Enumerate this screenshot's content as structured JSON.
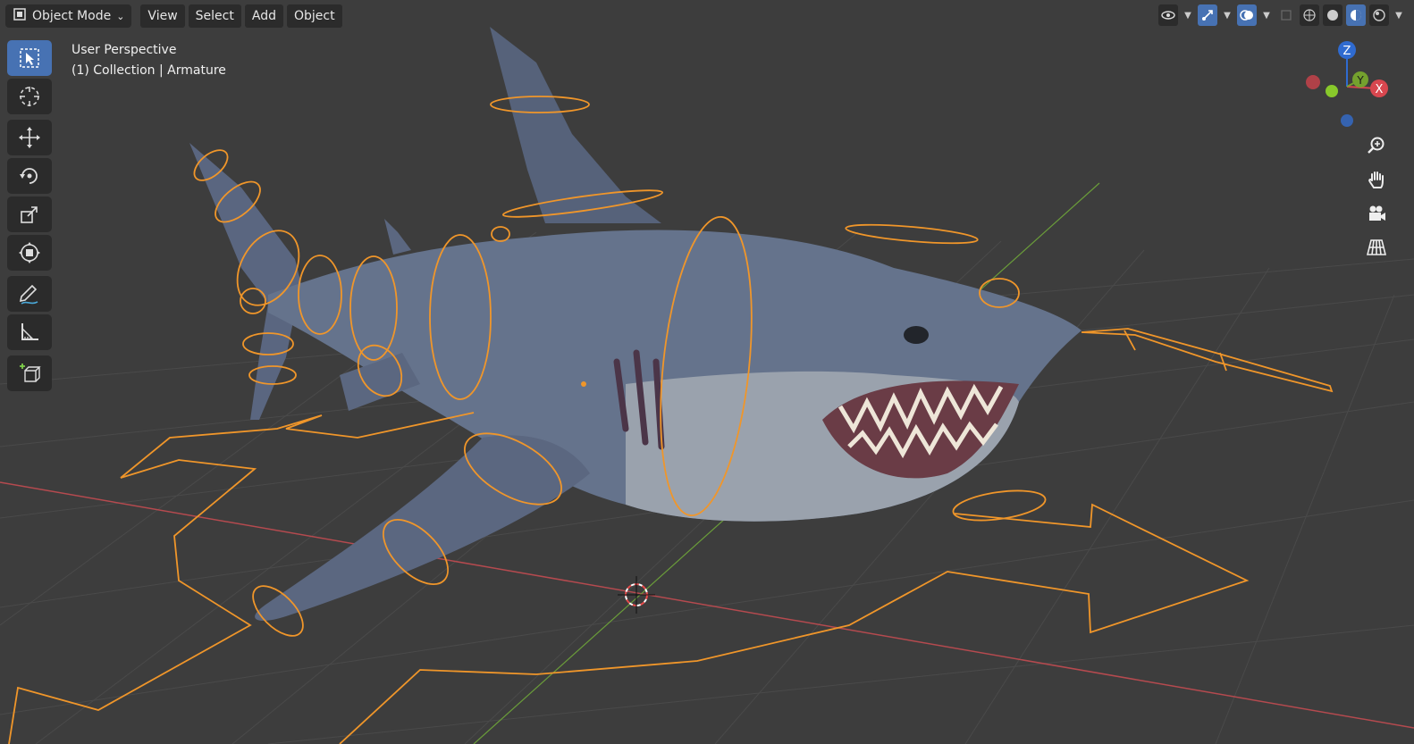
{
  "header": {
    "mode_label": "Object Mode",
    "menus": [
      "View",
      "Select",
      "Add",
      "Object"
    ]
  },
  "overlay": {
    "line1": "User Perspective",
    "line2": "(1) Collection | Armature"
  },
  "gizmo": {
    "x": "X",
    "y": "Y",
    "z": "Z"
  },
  "toolbar_items": [
    "select-box",
    "cursor",
    "move",
    "rotate",
    "scale",
    "transform",
    "annotate",
    "measure",
    "add-cube"
  ],
  "colors": {
    "background": "#3d3d3d",
    "grid": "#4a4a4a",
    "x_axis": "#b54a4f",
    "y_axis": "#6a9c3a",
    "armature": "#f0962a",
    "active_button": "#4772b3",
    "shark_body": "#65738c",
    "shark_belly": "#9aa2ad"
  }
}
